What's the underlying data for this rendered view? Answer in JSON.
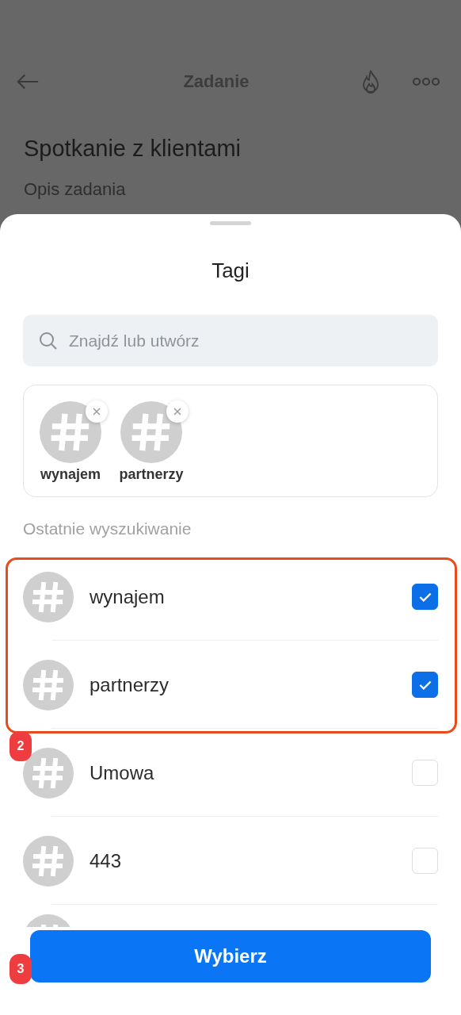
{
  "page": {
    "title": "Zadanie",
    "task_title": "Spotkanie z klientami",
    "description_label": "Opis zadania"
  },
  "sheet": {
    "title": "Tagi",
    "search": {
      "placeholder": "Znajdź lub utwórz"
    },
    "chosen": [
      {
        "label": "wynajem"
      },
      {
        "label": "partnerzy"
      }
    ],
    "section_label": "Ostatnie wyszukiwanie",
    "items": [
      {
        "label": "wynajem",
        "checked": true
      },
      {
        "label": "partnerzy",
        "checked": true
      },
      {
        "label": "Umowa",
        "checked": false
      },
      {
        "label": "443",
        "checked": false
      }
    ],
    "confirm_button": "Wybierz"
  },
  "annotations": [
    {
      "label": "2"
    },
    {
      "label": "3"
    }
  ]
}
